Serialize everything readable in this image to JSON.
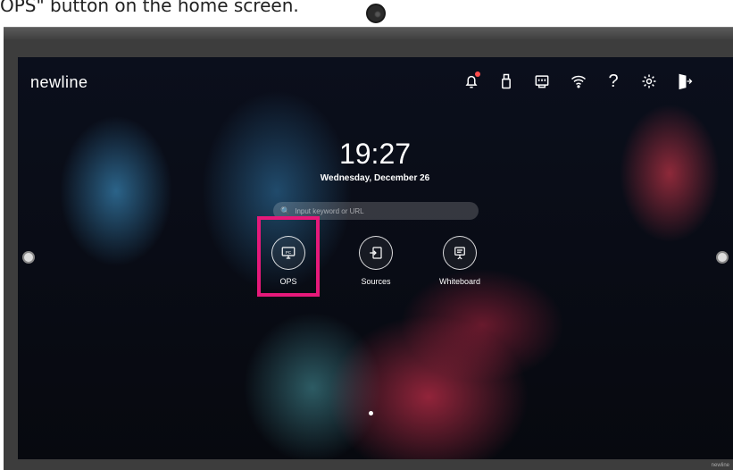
{
  "caption": "OPS\" button on the home screen.",
  "brand": {
    "logo_text": "newline",
    "bezel_text": "newline"
  },
  "status_icons": [
    {
      "name": "notification-bell-icon",
      "has_badge": true
    },
    {
      "name": "usb-storage-icon"
    },
    {
      "name": "ethernet-icon"
    },
    {
      "name": "wifi-icon"
    },
    {
      "name": "help-icon",
      "glyph": "?"
    },
    {
      "name": "settings-gear-icon"
    },
    {
      "name": "exit-icon"
    }
  ],
  "clock": {
    "time": "19:27",
    "date": "Wednesday, December 26"
  },
  "search": {
    "placeholder": "Input keyword or URL"
  },
  "apps": [
    {
      "label": "OPS",
      "icon": "pc-icon",
      "icon_text": "PC",
      "highlighted": true
    },
    {
      "label": "Sources",
      "icon": "input-source-icon"
    },
    {
      "label": "Whiteboard",
      "icon": "whiteboard-icon"
    }
  ],
  "colors": {
    "highlight": "#e6197a",
    "badge": "#ff4d4d"
  },
  "pager": {
    "current": 1
  }
}
